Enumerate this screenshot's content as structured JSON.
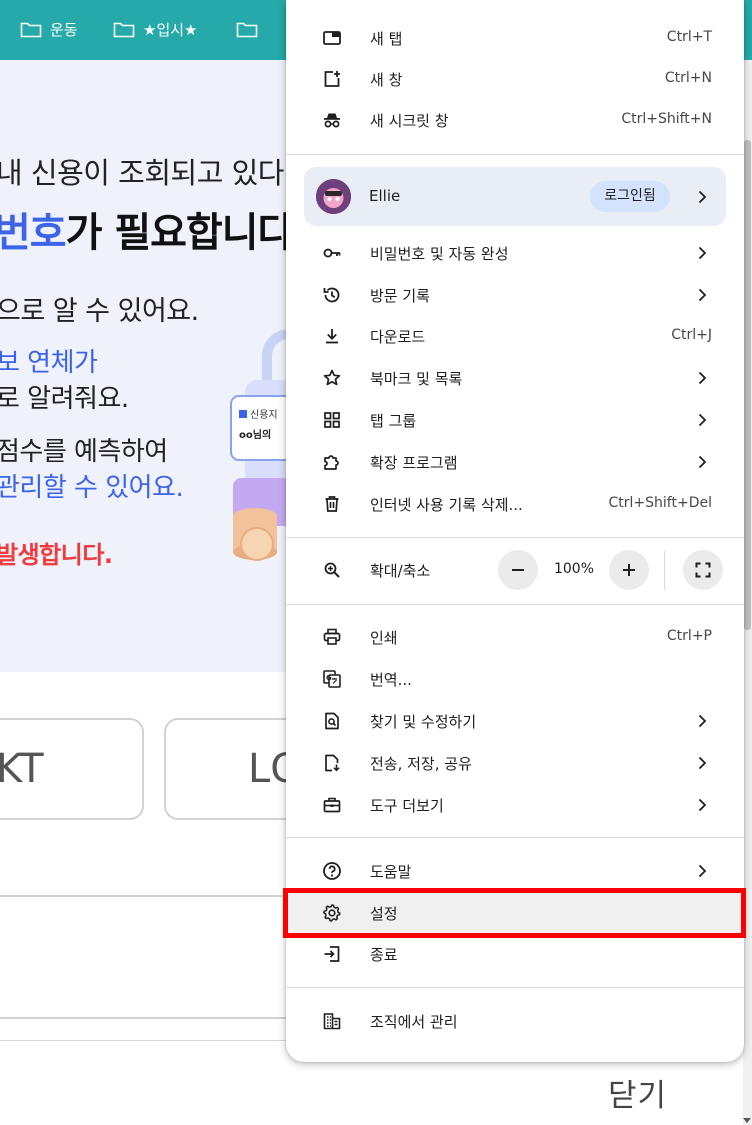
{
  "bookmarks": [
    {
      "label": "운동",
      "icon": "folder-icon"
    },
    {
      "label": "★입시★",
      "icon": "folder-icon"
    },
    {
      "label": "",
      "icon": "folder-icon"
    }
  ],
  "page": {
    "hero_lines": [
      "내 신용이 조회되고 있다",
      "번호",
      "가 필요합니다",
      "으로 알 수 있어요.",
      "보 연체가",
      "로 알려줘요.",
      "점수를 예측하여",
      "관리할 수 있어요.",
      "발생합니다."
    ],
    "illus_text": [
      "신용지",
      "oo님의"
    ],
    "carrier_kt": "KT",
    "carrier_lg": "LG",
    "close_label": "닫기"
  },
  "menu": {
    "new_tab": {
      "label": "새 탭",
      "shortcut": "Ctrl+T",
      "icon": "new-tab-icon"
    },
    "new_window": {
      "label": "새 창",
      "shortcut": "Ctrl+N",
      "icon": "new-window-icon"
    },
    "incognito": {
      "label": "새 시크릿 창",
      "shortcut": "Ctrl+Shift+N",
      "icon": "incognito-icon"
    },
    "profile": {
      "name": "Ellie",
      "badge": "로그인됨"
    },
    "passwords": {
      "label": "비밀번호 및 자동 완성",
      "icon": "key-icon"
    },
    "history": {
      "label": "방문 기록",
      "icon": "history-icon"
    },
    "downloads": {
      "label": "다운로드",
      "shortcut": "Ctrl+J",
      "icon": "download-icon"
    },
    "bookmarks": {
      "label": "북마크 및 목록",
      "icon": "star-icon"
    },
    "tab_groups": {
      "label": "탭 그룹",
      "icon": "grid-icon"
    },
    "extensions": {
      "label": "확장 프로그램",
      "icon": "puzzle-icon"
    },
    "clear_data": {
      "label": "인터넷 사용 기록 삭제...",
      "shortcut": "Ctrl+Shift+Del",
      "icon": "trash-icon"
    },
    "zoom": {
      "label": "확대/축소",
      "value": "100%",
      "icon": "zoom-icon"
    },
    "print": {
      "label": "인쇄",
      "shortcut": "Ctrl+P",
      "icon": "print-icon"
    },
    "translate": {
      "label": "번역...",
      "icon": "translate-icon"
    },
    "find_edit": {
      "label": "찾기 및 수정하기",
      "icon": "find-icon"
    },
    "cast_save_share": {
      "label": "전송, 저장, 공유",
      "icon": "save-share-icon"
    },
    "more_tools": {
      "label": "도구 더보기",
      "icon": "toolbox-icon"
    },
    "help": {
      "label": "도움말",
      "icon": "help-icon"
    },
    "settings": {
      "label": "설정",
      "icon": "gear-icon"
    },
    "exit": {
      "label": "종료",
      "icon": "exit-icon"
    },
    "managed": {
      "label": "조직에서 관리",
      "icon": "building-icon"
    }
  },
  "colors": {
    "bookmark_bar": "#25a9a9",
    "accent_blue": "#3c63e8",
    "alert_red": "#ef3b3b",
    "highlight_box": "#ff0000",
    "profile_bg": "#e9eef6",
    "badge_bg": "#d3e3fd"
  }
}
